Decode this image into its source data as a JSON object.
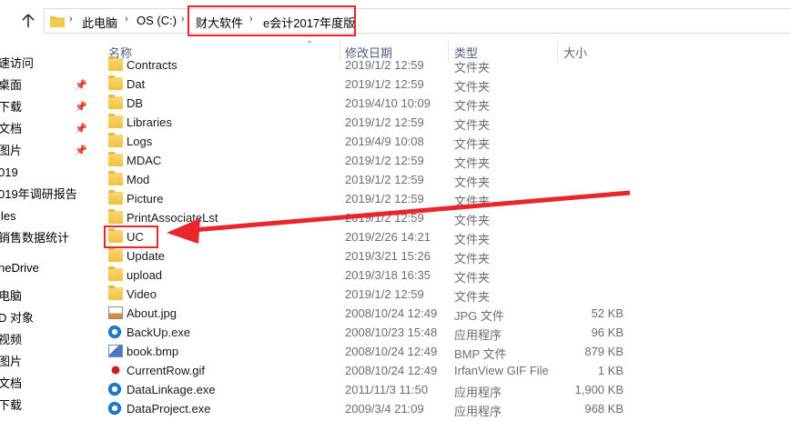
{
  "address": {
    "crumbs": [
      "此电脑",
      "OS (C:)",
      "财大软件",
      "e会计2017年度版"
    ],
    "separator": "›"
  },
  "nav": {
    "items": [
      {
        "label": "速访问",
        "pinned": false
      },
      {
        "label": "桌面",
        "pinned": true
      },
      {
        "label": "下载",
        "pinned": true
      },
      {
        "label": "文档",
        "pinned": true
      },
      {
        "label": "图片",
        "pinned": true
      },
      {
        "label": "019",
        "pinned": false
      },
      {
        "label": "019年调研报告",
        "pinned": false
      },
      {
        "label": "iles",
        "pinned": false
      },
      {
        "label": "销售数据统计",
        "pinned": false
      },
      {
        "label": "neDrive",
        "pinned": false
      },
      {
        "label": "电脑",
        "pinned": false
      },
      {
        "label": "D 对象",
        "pinned": false
      },
      {
        "label": "视频",
        "pinned": false
      },
      {
        "label": "图片",
        "pinned": false
      },
      {
        "label": "文档",
        "pinned": false
      },
      {
        "label": "下载",
        "pinned": false
      }
    ]
  },
  "columns": {
    "name": "名称",
    "date": "修改日期",
    "type": "类型",
    "size": "大小"
  },
  "files": [
    {
      "name": "Contracts",
      "date": "2019/1/2 12:59",
      "type": "文件夹",
      "size": "",
      "icon": "folder-icon"
    },
    {
      "name": "Dat",
      "date": "2019/1/2 12:59",
      "type": "文件夹",
      "size": "",
      "icon": "folder-icon"
    },
    {
      "name": "DB",
      "date": "2019/4/10 10:09",
      "type": "文件夹",
      "size": "",
      "icon": "folder-icon"
    },
    {
      "name": "Libraries",
      "date": "2019/1/2 12:59",
      "type": "文件夹",
      "size": "",
      "icon": "folder-icon"
    },
    {
      "name": "Logs",
      "date": "2019/4/9 10:08",
      "type": "文件夹",
      "size": "",
      "icon": "folder-icon"
    },
    {
      "name": "MDAC",
      "date": "2019/1/2 12:59",
      "type": "文件夹",
      "size": "",
      "icon": "folder-icon"
    },
    {
      "name": "Mod",
      "date": "2019/1/2 12:59",
      "type": "文件夹",
      "size": "",
      "icon": "folder-icon"
    },
    {
      "name": "Picture",
      "date": "2019/1/2 12:59",
      "type": "文件夹",
      "size": "",
      "icon": "folder-icon"
    },
    {
      "name": "PrintAssociateLst",
      "date": "2019/1/2 12:59",
      "type": "文件夹",
      "size": "",
      "icon": "folder-icon"
    },
    {
      "name": "UC",
      "date": "2019/2/26 14:21",
      "type": "文件夹",
      "size": "",
      "icon": "folder-icon"
    },
    {
      "name": "Update",
      "date": "2019/3/21 15:26",
      "type": "文件夹",
      "size": "",
      "icon": "folder-icon"
    },
    {
      "name": "upload",
      "date": "2019/3/18 16:35",
      "type": "文件夹",
      "size": "",
      "icon": "folder-icon"
    },
    {
      "name": "Video",
      "date": "2019/1/2 12:59",
      "type": "文件夹",
      "size": "",
      "icon": "folder-icon"
    },
    {
      "name": "About.jpg",
      "date": "2008/10/24 12:49",
      "type": "JPG 文件",
      "size": "52 KB",
      "icon": "jpg-file-icon"
    },
    {
      "name": "BackUp.exe",
      "date": "2008/10/23 15:48",
      "type": "应用程序",
      "size": "96 KB",
      "icon": "exe-app-icon"
    },
    {
      "name": "book.bmp",
      "date": "2008/10/24 12:49",
      "type": "BMP 文件",
      "size": "879 KB",
      "icon": "bmp-file-icon"
    },
    {
      "name": "CurrentRow.gif",
      "date": "2008/10/24 12:49",
      "type": "IrfanView GIF File",
      "size": "1 KB",
      "icon": "gif-file-icon"
    },
    {
      "name": "DataLinkage.exe",
      "date": "2011/11/3 11:50",
      "type": "应用程序",
      "size": "1,900 KB",
      "icon": "exe-app-icon"
    },
    {
      "name": "DataProject.exe",
      "date": "2009/3/4 21:09",
      "type": "应用程序",
      "size": "968 KB",
      "icon": "exe-app-icon"
    }
  ],
  "colors": {
    "highlight": "#e8262b",
    "folder": "#f3c94f",
    "header_text": "#4c607a"
  }
}
